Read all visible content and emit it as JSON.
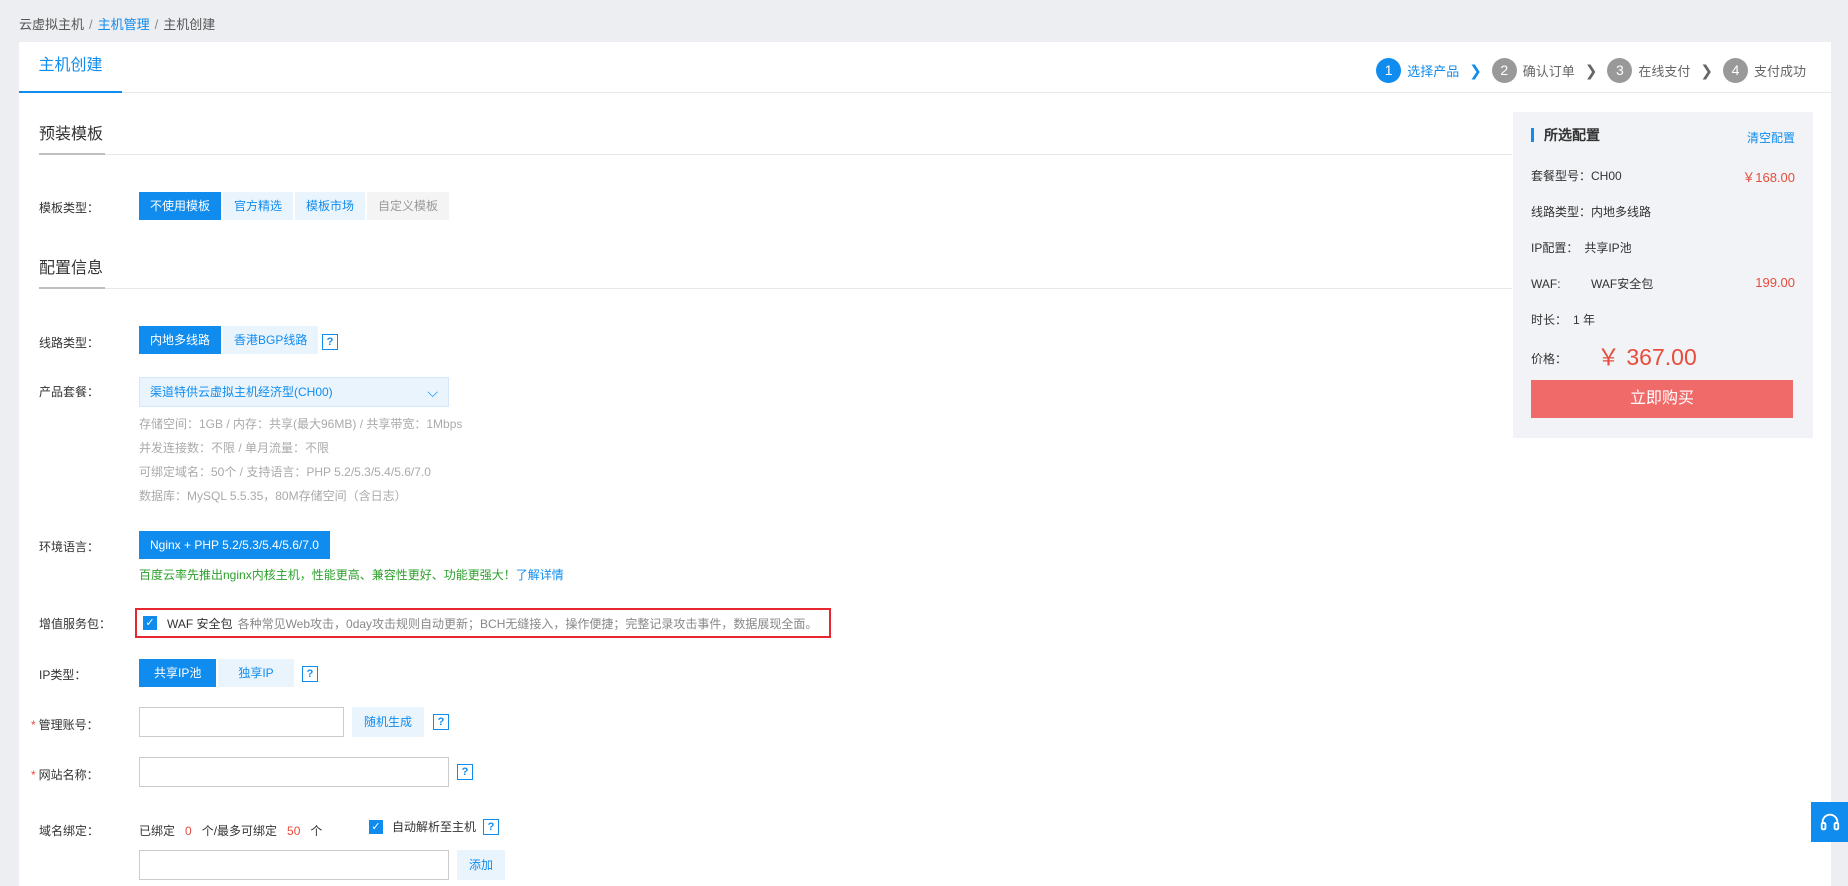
{
  "breadcrumb": [
    "云虚拟主机",
    "主机管理",
    "主机创建"
  ],
  "page_title": "主机创建",
  "steps": [
    {
      "num": "1",
      "label": "选择产品"
    },
    {
      "num": "2",
      "label": "确认订单"
    },
    {
      "num": "3",
      "label": "在线支付"
    },
    {
      "num": "4",
      "label": "支付成功"
    }
  ],
  "sections": {
    "preset": "预装模板",
    "config": "配置信息"
  },
  "template": {
    "label": "模板类型：",
    "options": [
      "不使用模板",
      "官方精选",
      "模板市场",
      "自定义模板"
    ]
  },
  "line": {
    "label": "线路类型：",
    "options": [
      "内地多线路",
      "香港BGP线路"
    ]
  },
  "package": {
    "label": "产品套餐：",
    "selected": "渠道特供云虚拟主机经济型(CH00)",
    "specs": [
      "存储空间：1GB / 内存：共享(最大96MB) / 共享带宽：1Mbps",
      "并发连接数：不限 / 单月流量：不限",
      "可绑定域名：50个 / 支持语言：PHP 5.2/5.3/5.4/5.6/7.0",
      "数据库：MySQL 5.5.35，80M存储空间（含日志）"
    ]
  },
  "env": {
    "label": "环境语言：",
    "option": "Nginx + PHP 5.2/5.3/5.4/5.6/7.0",
    "note": "百度云率先推出nginx内核主机，性能更高、兼容性更好、功能更强大！",
    "note_link": "了解详情"
  },
  "addon": {
    "label": "增值服务包：",
    "name": "WAF 安全包",
    "desc": "各种常见Web攻击，0day攻击规则自动更新；BCH无缝接入，操作便捷；完整记录攻击事件，数据展现全面。"
  },
  "ip": {
    "label": "IP类型：",
    "options": [
      "共享IP池",
      "独享IP"
    ]
  },
  "account": {
    "label": "管理账号：",
    "value": "",
    "generate": "随机生成"
  },
  "site": {
    "label": "网站名称：",
    "value": ""
  },
  "domain": {
    "label": "域名绑定：",
    "bound_prefix": "已绑定",
    "bound": "0",
    "max_prefix": "个/最多可绑定",
    "max": "50",
    "unit": "个",
    "auto_label": "自动解析至主机",
    "add": "添加"
  },
  "summary": {
    "title": "所选配置",
    "clear": "清空配置",
    "rows": [
      {
        "label": "套餐型号：",
        "value": "CH00",
        "price": "￥168.00"
      },
      {
        "label": "线路类型：",
        "value": "内地多线路",
        "price": ""
      },
      {
        "label": "IP配置：",
        "value": "共享IP池",
        "price": ""
      },
      {
        "label": "WAF:",
        "value": "WAF安全包",
        "price": "199.00"
      },
      {
        "label": "时长：",
        "value": "1 年",
        "price": ""
      }
    ],
    "total_label": "价格：",
    "total": "￥ 367.00",
    "buy": "立即购买"
  },
  "help_mark": "?",
  "check_mark": "✓",
  "caret": "⌄",
  "colors": {
    "accent": "#108cee",
    "danger": "#e74c3c",
    "buy": "#f06a6a",
    "highlight_border": "#e8262e"
  }
}
